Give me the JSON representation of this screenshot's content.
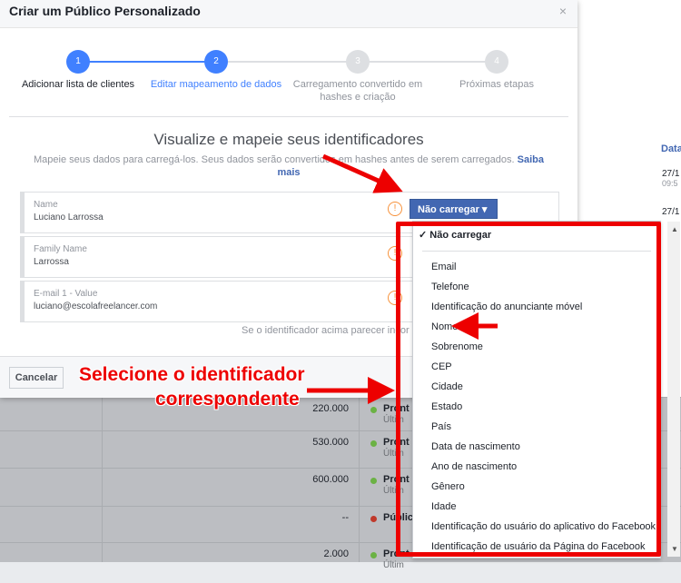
{
  "modal": {
    "title": "Criar um Público Personalizado",
    "close": "×",
    "steps": [
      {
        "num": "1",
        "label": "Adicionar lista de clientes"
      },
      {
        "num": "2",
        "label": "Editar mapeamento de dados"
      },
      {
        "num": "3",
        "label": "Carregamento convertido em hashes e criação"
      },
      {
        "num": "4",
        "label": "Próximas etapas"
      }
    ],
    "heading": "Visualize e mapeie seus identificadores",
    "subtext": "Mapeie seus dados para carregá-los. Seus dados serão convertidos em hashes antes de serem carregados.",
    "learn_more": "Saiba mais",
    "fields": [
      {
        "label": "Name",
        "value": "Luciano Larrossa"
      },
      {
        "label": "Family Name",
        "value": "Larrossa"
      },
      {
        "label": "E-mail 1 - Value",
        "value": "luciano@escolafreelancer.com"
      }
    ],
    "warn_icon": "!",
    "dropdown_label": "Não carregar ▾",
    "hint": "Se o identificador acima parecer incor",
    "cancel": "Cancelar"
  },
  "menu": {
    "selected": "✓ Não carregar",
    "items": [
      "Email",
      "Telefone",
      "Identificação do anunciante móvel",
      "Nome",
      "Sobrenome",
      "CEP",
      "Cidade",
      "Estado",
      "País",
      "Data de nascimento",
      "Ano de nascimento",
      "Gênero",
      "Idade",
      "Identificação do usuário do aplicativo do Facebook",
      "Identificação de usuário da Página do Facebook"
    ]
  },
  "background": {
    "date_header": "Data",
    "date_rows": [
      {
        "date": "27/1",
        "time": "09:5"
      },
      {
        "date": "27/1",
        "time": ""
      }
    ],
    "rows": [
      {
        "amount": "220.000",
        "status": "Pront",
        "sub": "Últim",
        "color": "#6bb244"
      },
      {
        "amount": "530.000",
        "status": "Pront",
        "sub": "Últim",
        "color": "#6bb244"
      },
      {
        "amount": "600.000",
        "status": "Pront",
        "sub": "Últim",
        "color": "#6bb244"
      },
      {
        "amount": "--",
        "status": "Públic",
        "sub": "",
        "color": "#c0392b"
      },
      {
        "amount": "2.000",
        "status": "Pront",
        "sub": "Últim",
        "color": "#6bb244"
      }
    ]
  },
  "annotation": {
    "line1": "Selecione o identificador",
    "line2": "correspondente"
  },
  "colors": {
    "accent": "#4267b2",
    "step_active": "#4080ff",
    "step_inactive": "#dddfe2",
    "annotation": "#ed0000"
  }
}
